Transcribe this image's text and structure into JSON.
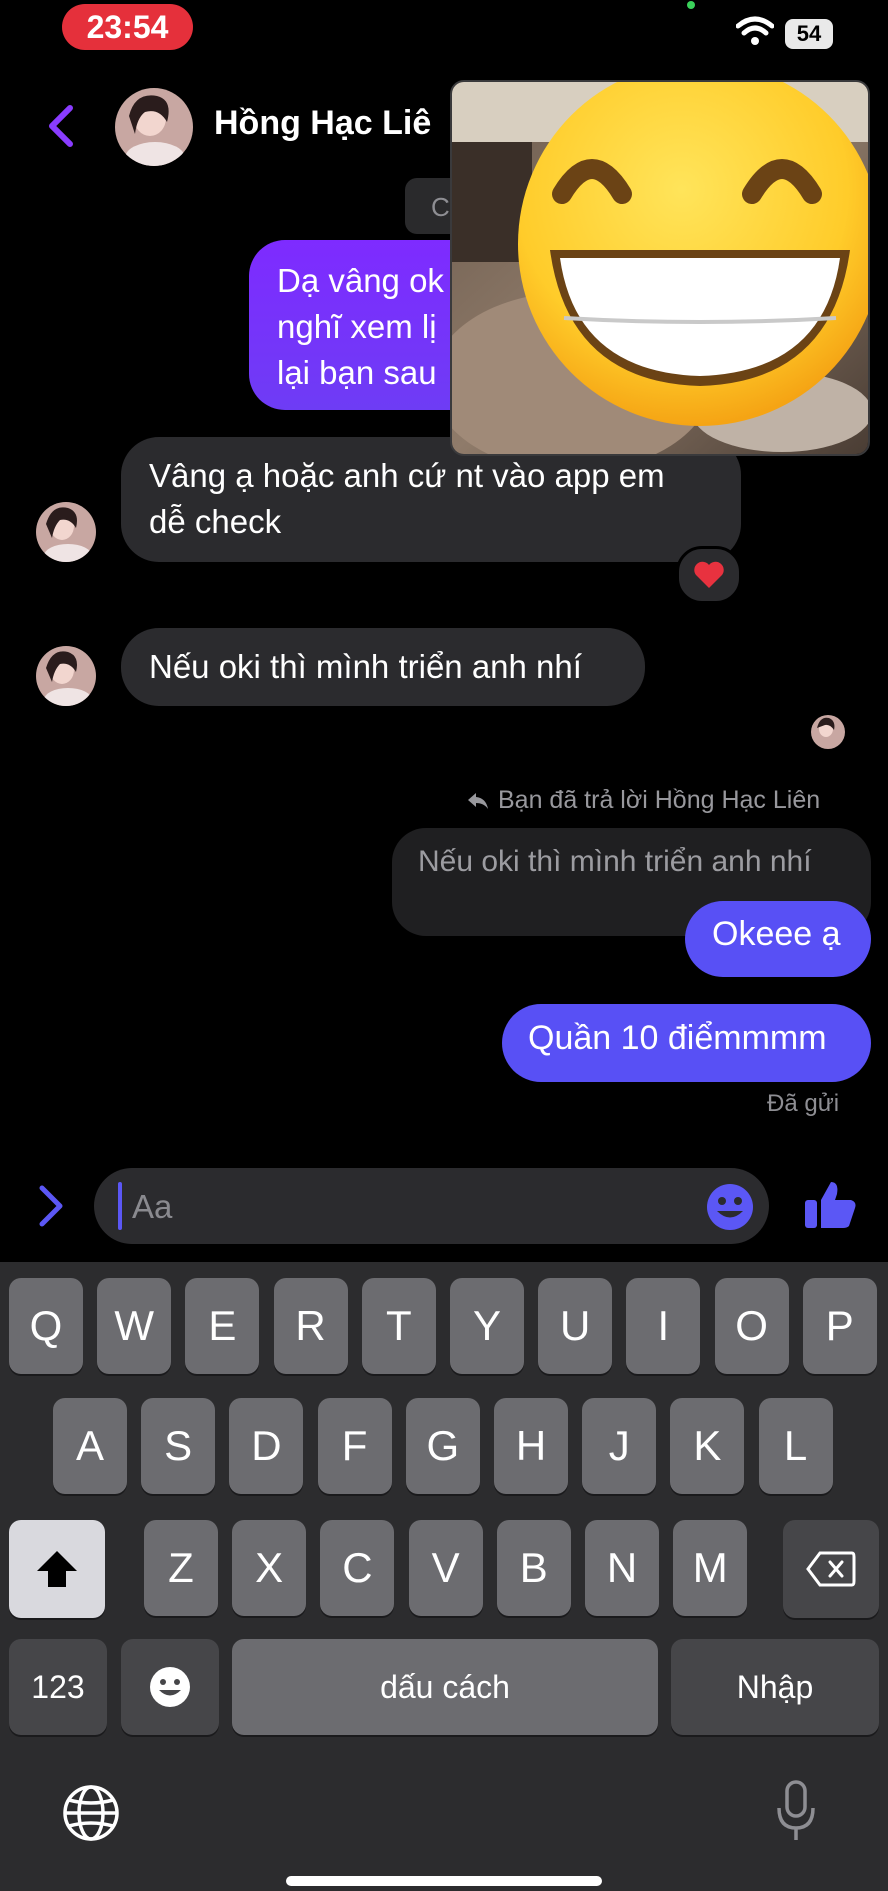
{
  "status_bar": {
    "time": "23:54",
    "battery": "54"
  },
  "header": {
    "contact_name": "Hồng Hạc Liê",
    "hidden_label": "C"
  },
  "messages": {
    "sent_partial": "Dạ vâng ok\nnghĩ xem lị\nlại bạn sau",
    "received_1": "Vâng ạ hoặc anh cứ nt vào app em\ndễ check",
    "received_1_reaction": "❤️",
    "received_2": "Nếu oki thì mình triển anh nhí",
    "reply_note": "Bạn đã trả lời Hồng Hạc Liên",
    "quoted": "Nếu oki thì mình triển anh nhí",
    "sent_1": "Okeee ạ",
    "sent_2": "Quần 10 điểmmmm",
    "status": "Đã gửi"
  },
  "composer": {
    "placeholder": "Aa"
  },
  "keyboard": {
    "row1": [
      "Q",
      "W",
      "E",
      "R",
      "T",
      "Y",
      "U",
      "I",
      "O",
      "P"
    ],
    "row2": [
      "A",
      "S",
      "D",
      "F",
      "G",
      "H",
      "J",
      "K",
      "L"
    ],
    "row3": [
      "Z",
      "X",
      "C",
      "V",
      "B",
      "N",
      "M"
    ],
    "numbers_label": "123",
    "space_label": "dấu cách",
    "return_label": "Nhập"
  },
  "colors": {
    "accent_purple": "#7e2bff",
    "accent_blue": "#5850f5",
    "incoming_bubble": "#2b2b2e",
    "time_pill": "#e5303b"
  }
}
